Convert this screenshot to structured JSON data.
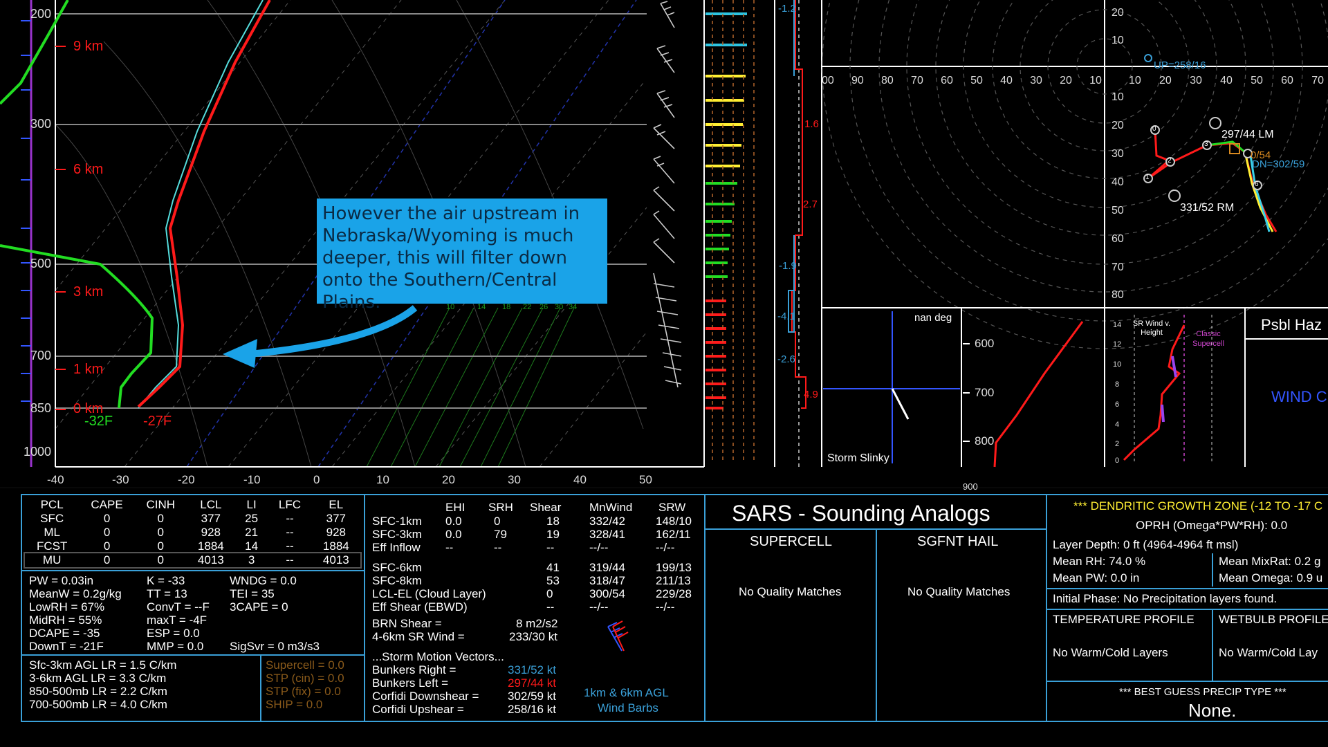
{
  "skewt": {
    "pressure_labels": [
      "200",
      "300",
      "500",
      "700",
      "850",
      "1000"
    ],
    "height_labels": [
      "9 km",
      "6 km",
      "3 km",
      "1 km",
      "0 km"
    ],
    "temp_axis": [
      "-40",
      "-30",
      "-20",
      "-10",
      "0",
      "10",
      "20",
      "30",
      "40",
      "50"
    ],
    "sfc_dew": "-32F",
    "sfc_temp": "-27F",
    "mixing_labels": [
      "10",
      "14",
      "18",
      "22",
      "26",
      "30",
      "34"
    ]
  },
  "callout": {
    "text": "However the air upstream in Nebraska/Wyoming is much deeper, this will filter down onto the Southern/Central Plains."
  },
  "omega": {
    "values": [
      "-1.2",
      "1.6",
      "2.7",
      "-1.9",
      "-4.1",
      "-2.6",
      "4.9"
    ]
  },
  "hodograph": {
    "axis_left": [
      "00",
      "90",
      "80",
      "70",
      "60",
      "50",
      "40",
      "30",
      "20",
      "10"
    ],
    "axis_right": [
      "10",
      "20",
      "30",
      "40",
      "50",
      "60",
      "70"
    ],
    "axis_y": [
      "20",
      "10",
      "10",
      "20",
      "30",
      "40",
      "50",
      "60",
      "70",
      "80"
    ],
    "up_label": "UP=258/16",
    "lm_label": "297/44 LM",
    "dn_label": "DN=302/59",
    "mean_label": "0/54",
    "rm_label": "331/52 RM",
    "points": [
      "0",
      "1",
      "2",
      "3",
      "6"
    ]
  },
  "storm_slinky": {
    "deg": "nan deg",
    "label": "Storm Slinky"
  },
  "theta": {
    "labels": [
      "600",
      "700",
      "800",
      "900"
    ]
  },
  "sr_wind": {
    "title": "SR Wind v. Height",
    "classic": "Classic Supercell",
    "ticks": [
      "14",
      "12",
      "10",
      "8",
      "6",
      "4",
      "2",
      "0"
    ]
  },
  "psbl": {
    "title": "Psbl Haz",
    "value": "WIND C"
  },
  "parcels": {
    "headers": [
      "PCL",
      "CAPE",
      "CINH",
      "LCL",
      "LI",
      "LFC",
      "EL"
    ],
    "rows": [
      [
        "SFC",
        "0",
        "0",
        "377",
        "25",
        "--",
        "377"
      ],
      [
        "ML",
        "0",
        "0",
        "928",
        "21",
        "--",
        "928"
      ],
      [
        "FCST",
        "0",
        "0",
        "1884",
        "14",
        "--",
        "1884"
      ],
      [
        "MU",
        "0",
        "0",
        "4013",
        "3",
        "--",
        "4013"
      ]
    ]
  },
  "indices": {
    "col1": [
      "PW = 0.03in",
      "MeanW = 0.2g/kg",
      "LowRH = 67%",
      "MidRH = 55%",
      "DCAPE = -35",
      "DownT = -21F"
    ],
    "col2": [
      "K = -33",
      "TT = 13",
      "ConvT = --F",
      "maxT = -4F",
      "ESP = 0.0",
      "MMP = 0.0"
    ],
    "col3": [
      "WNDG = 0.0",
      "TEI = 35",
      "3CAPE = 0",
      "",
      "",
      "SigSvr = 0 m3/s3"
    ]
  },
  "lapse": [
    "Sfc-3km AGL LR = 1.5 C/km",
    "3-6km AGL LR = 3.3 C/km",
    "850-500mb LR = 2.2 C/km",
    "700-500mb LR = 4.0 C/km"
  ],
  "composite": [
    "Supercell = 0.0",
    "STP (cin) = 0.0",
    "STP (fix) = 0.0",
    "SHIP = 0.0"
  ],
  "kinematics": {
    "headers": [
      "EHI",
      "SRH",
      "Shear",
      "MnWind",
      "SRW"
    ],
    "rows": [
      [
        "SFC-1km",
        "0.0",
        "0",
        "18",
        "332/42",
        "148/10"
      ],
      [
        "SFC-3km",
        "0.0",
        "79",
        "19",
        "328/41",
        "162/11"
      ],
      [
        "Eff Inflow",
        "--",
        "--",
        "--",
        "--/--",
        "--/--"
      ],
      [
        "SFC-6km",
        "",
        "",
        "41",
        "319/44",
        "199/13"
      ],
      [
        "SFC-8km",
        "",
        "",
        "53",
        "318/47",
        "211/13"
      ],
      [
        "LCL-EL (Cloud Layer)",
        "",
        "",
        "0",
        "300/54",
        "229/28"
      ],
      [
        "Eff Shear (EBWD)",
        "",
        "",
        "--",
        "--/--",
        "--/--"
      ]
    ],
    "brn_label": "BRN Shear =",
    "brn_value": "8 m2/s2",
    "srwind_label": "4-6km SR Wind =",
    "srwind_value": "233/30 kt",
    "vectors_title": "...Storm Motion Vectors...",
    "vectors": [
      [
        "Bunkers Right =",
        "331/52 kt"
      ],
      [
        "Bunkers Left =",
        "297/44 kt"
      ],
      [
        "Corfidi Downshear =",
        "302/59 kt"
      ],
      [
        "Corfidi Upshear =",
        "258/16 kt"
      ]
    ],
    "barb_label1": "1km & 6km AGL",
    "barb_label2": "Wind Barbs"
  },
  "sars": {
    "title": "SARS - Sounding Analogs",
    "col1": "SUPERCELL",
    "col2": "SGFNT HAIL",
    "none1": "No Quality Matches",
    "none2": "No Quality Matches"
  },
  "dgz": {
    "title": "*** DENDRITIC GROWTH ZONE (-12 TO -17 C",
    "oprh": "OPRH (Omega*PW*RH): 0.0",
    "depth": "Layer Depth: 0 ft (4964-4964 ft msl)",
    "rh": "Mean RH: 74.0 %",
    "mixrat": "Mean MixRat: 0.2 g",
    "pw": "Mean PW: 0.0 in",
    "omega": "Mean Omega: 0.9 u",
    "phase": "Initial Phase:  No Precipitation layers found.",
    "temp_title": "TEMPERATURE PROFILE",
    "wb_title": "WETBULB PROFILE",
    "temp_val": "No Warm/Cold Layers",
    "wb_val": "No Warm/Cold Lay",
    "best": "*** BEST GUESS PRECIP TYPE ***",
    "none": "None."
  },
  "colors": {
    "temp": "#ff1a1a",
    "dew": "#22dd22",
    "frame": "#3aa0d8",
    "callout": "#1aa3e8",
    "yellow": "#ffee33"
  }
}
